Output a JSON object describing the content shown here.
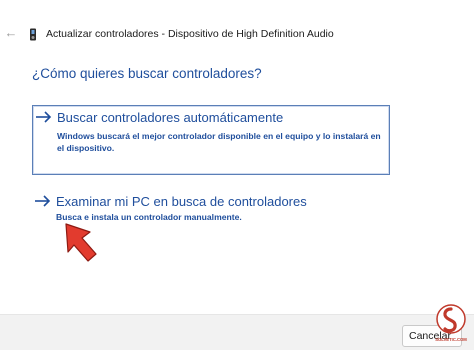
{
  "window": {
    "title": "Actualizar controladores - Dispositivo de High Definition Audio"
  },
  "main": {
    "question": "¿Cómo quieres buscar controladores?",
    "options": [
      {
        "title": "Buscar controladores automáticamente",
        "description": "Windows buscará el mejor controlador disponible en el equipo y lo instalará en el dispositivo."
      },
      {
        "title": "Examinar mi PC en busca de controladores",
        "description": "Busca e instala un controlador manualmente."
      }
    ]
  },
  "footer": {
    "cancel_label": "Cancelar"
  },
  "watermark": {
    "text": "SOLVETIC.COM",
    "color": "#c0392b"
  },
  "colors": {
    "link_blue": "#1f4e9c",
    "pointer_red": "#e23b2e"
  }
}
